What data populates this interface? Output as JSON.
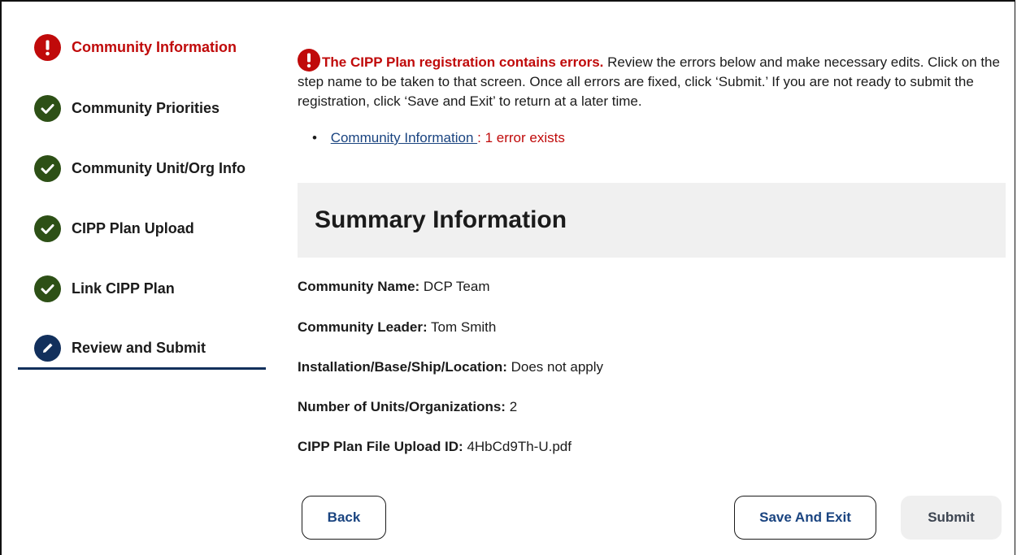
{
  "sidebar": {
    "steps": [
      {
        "label": "Community Information",
        "status": "error",
        "icon": "exclamation-icon"
      },
      {
        "label": "Community Priorities",
        "status": "complete",
        "icon": "check-icon"
      },
      {
        "label": "Community Unit/Org Info",
        "status": "complete",
        "icon": "check-icon"
      },
      {
        "label": "CIPP Plan Upload",
        "status": "complete",
        "icon": "check-icon"
      },
      {
        "label": "Link CIPP Plan",
        "status": "complete",
        "icon": "check-icon"
      },
      {
        "label": "Review and Submit",
        "status": "current",
        "icon": "pencil-icon"
      }
    ]
  },
  "alert": {
    "title": "The CIPP Plan registration contains errors.",
    "message": " Review the errors below and make necessary edits. Click on the step name to be taken to that screen. Once all errors are fixed, click ‘Submit.’ If you are not ready to submit the registration, click ‘Save and Exit’ to return at a later time.",
    "errors": [
      {
        "link": "Community Information ",
        "count_text": ": 1 error exists"
      }
    ]
  },
  "summary": {
    "heading": "Summary Information",
    "fields": [
      {
        "label": "Community Name:",
        "value": " DCP Team"
      },
      {
        "label": "Community Leader:",
        "value": " Tom Smith"
      },
      {
        "label": "Installation/Base/Ship/Location:",
        "value": " Does not apply"
      },
      {
        "label": "Number of Units/Organizations:",
        "value": " 2"
      },
      {
        "label": "CIPP Plan File Upload ID:",
        "value": " 4HbCd9Th-U.pdf"
      }
    ]
  },
  "buttons": {
    "back": "Back",
    "save_exit": "Save And Exit",
    "submit": "Submit"
  },
  "colors": {
    "error": "#c00a0a",
    "complete": "#2d5016",
    "current": "#12305c",
    "link": "#1a4480"
  }
}
